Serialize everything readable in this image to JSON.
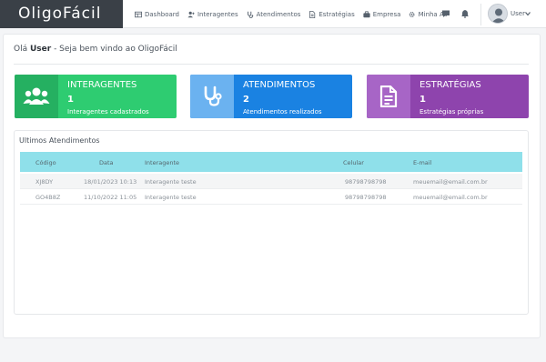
{
  "app": {
    "brand": "OligoFácil"
  },
  "nav": {
    "items": [
      {
        "label": "Dashboard",
        "icon": "dashboard-icon"
      },
      {
        "label": "Interagentes",
        "icon": "user-plus-icon"
      },
      {
        "label": "Atendimentos",
        "icon": "stethoscope-icon"
      },
      {
        "label": "Estratégias",
        "icon": "file-icon"
      },
      {
        "label": "Empresa",
        "icon": "briefcase-icon"
      },
      {
        "label": "Minha As",
        "icon": "gear-icon"
      }
    ],
    "user_label": "User"
  },
  "greeting": {
    "prefix": "Olá",
    "user": "User",
    "suffix": "- Seja bem vindo ao OligoFácil"
  },
  "stats": [
    {
      "title": "INTERAGENTES",
      "value": "1",
      "subtitle": "Interagentes cadastrados",
      "color": "#2ecc71"
    },
    {
      "title": "ATENDIMENTOS",
      "value": "2",
      "subtitle": "Atendimentos realizados",
      "color": "#1a82e2"
    },
    {
      "title": "ESTRATÉGIAS",
      "value": "1",
      "subtitle": "Estratégias próprias",
      "color": "#8e44ad"
    }
  ],
  "table": {
    "title": "Ultimos Atendimentos",
    "columns": [
      "Código",
      "Data",
      "Interagente",
      "Celular",
      "E-mail"
    ],
    "rows": [
      [
        "XJ8DY",
        "18/01/2023 10:13",
        "Interagente teste",
        "98798798798",
        "meuemail@email.com.br"
      ],
      [
        "GO4B8Z",
        "11/10/2022 11:05",
        "Interagente teste",
        "98798798798",
        "meuemail@email.com.br"
      ]
    ]
  },
  "colors": {
    "header_accent": "#8fe0ea",
    "brand_bg": "#3a4047"
  }
}
